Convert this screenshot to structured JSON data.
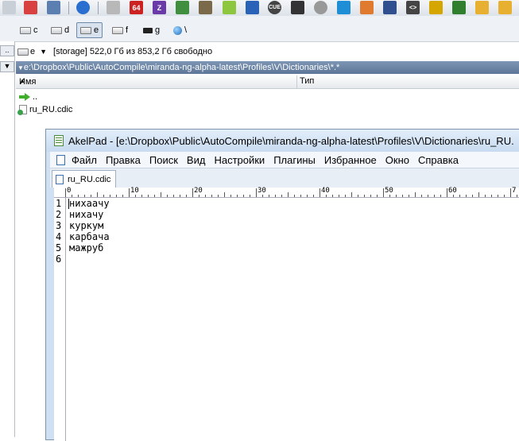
{
  "drives": [
    {
      "letter": "c",
      "type": "drive"
    },
    {
      "letter": "d",
      "type": "drive"
    },
    {
      "letter": "e",
      "type": "drive",
      "active": true
    },
    {
      "letter": "f",
      "type": "net"
    },
    {
      "letter": "g",
      "type": "usb"
    },
    {
      "letter": "\\",
      "type": "network-root"
    }
  ],
  "toolbar": {
    "badge_64": "64",
    "badge_z": "Z",
    "badge_cue": "CUE"
  },
  "panel": {
    "drive_combo": "e",
    "storage_info": "[storage]  522,0 Гб из 853,2 Гб свободно",
    "path": "e:\\Dropbox\\Public\\AutoCompile\\miranda-ng-alpha-latest\\Profiles\\V\\Dictionaries\\*.*",
    "col_name": "Имя",
    "col_type": "Тип",
    "files": [
      {
        "name": "..",
        "icon": "up-arrow-icon"
      },
      {
        "name": "ru_RU.cdic",
        "icon": "document-icon"
      }
    ]
  },
  "left_panel": {
    "btn1": "..",
    "btn2": "▼"
  },
  "akelpad": {
    "title": "AkelPad - [e:\\Dropbox\\Public\\AutoCompile\\miranda-ng-alpha-latest\\Profiles\\V\\Dictionaries\\ru_RU.",
    "menu": [
      "Файл",
      "Правка",
      "Поиск",
      "Вид",
      "Настройки",
      "Плагины",
      "Избранное",
      "Окно",
      "Справка"
    ],
    "tab_label": "ru_RU.cdic",
    "ruler_labels": [
      "0",
      "10",
      "20",
      "30",
      "40",
      "50",
      "60",
      "7"
    ],
    "lines": [
      "нихаачу",
      "нихачу",
      "куркум",
      "карбача",
      "мажруб",
      ""
    ],
    "line_numbers": [
      "1",
      "2",
      "3",
      "4",
      "5",
      "6"
    ]
  }
}
